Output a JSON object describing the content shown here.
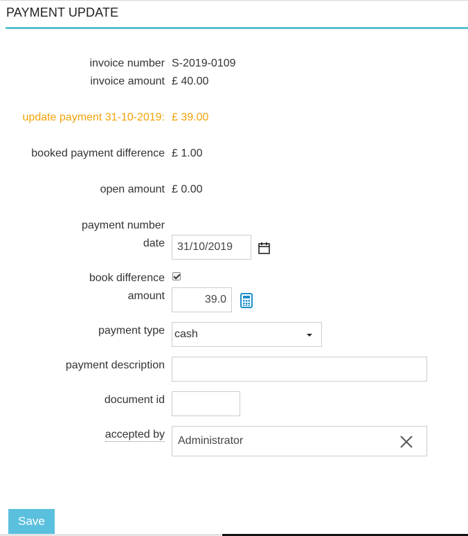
{
  "header": {
    "title": "PAYMENT UPDATE"
  },
  "invoice": {
    "number_label": "invoice number",
    "number_value": "S-2019-0109",
    "amount_label": "invoice amount",
    "amount_value": "£ 40.00"
  },
  "update": {
    "label": "update payment 31-10-2019:",
    "value": "£ 39.00",
    "color": "#f0a30a"
  },
  "booked_difference": {
    "label": "booked payment difference",
    "value": "£ 1.00"
  },
  "open_amount": {
    "label": "open amount",
    "value": "£ 0.00"
  },
  "form": {
    "payment_number_label": "payment number",
    "date_label": "date",
    "date_value": "31/10/2019",
    "book_difference_label": "book difference",
    "book_difference_checked": true,
    "amount_label": "amount",
    "amount_value": "39.0",
    "payment_type_label": "payment type",
    "payment_type_value": "cash",
    "payment_description_label": "payment description",
    "payment_description_value": "",
    "document_id_label": "document id",
    "document_id_value": "",
    "accepted_by_label": "accepted by",
    "accepted_by_value": "Administrator"
  },
  "icons": {
    "date_picker": "calendar-icon",
    "amount_calc": "calculator-icon",
    "accepted_clear": "close-icon"
  },
  "actions": {
    "save_label": "Save"
  },
  "colors": {
    "accent": "#5bc0ce",
    "button": "#5bc0de",
    "calculator": "#1a8fcc"
  }
}
